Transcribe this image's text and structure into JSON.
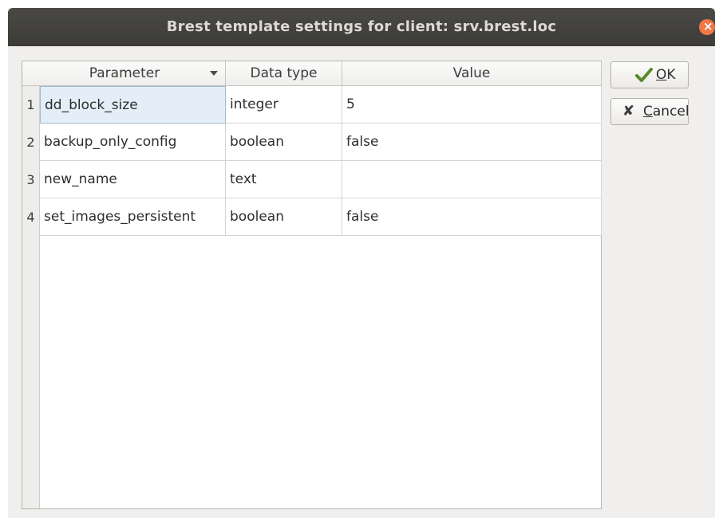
{
  "window": {
    "title": "Brest template settings for client: srv.brest.loc"
  },
  "table": {
    "columns": [
      "Parameter",
      "Data type",
      "Value"
    ],
    "rows": [
      {
        "num": "1",
        "parameter": "dd_block_size",
        "type": "integer",
        "value": "5"
      },
      {
        "num": "2",
        "parameter": "backup_only_config",
        "type": "boolean",
        "value": "false"
      },
      {
        "num": "3",
        "parameter": "new_name",
        "type": "text",
        "value": ""
      },
      {
        "num": "4",
        "parameter": "set_images_persistent",
        "type": "boolean",
        "value": "false"
      }
    ]
  },
  "buttons": {
    "ok": {
      "mnemonic": "O",
      "rest": "K"
    },
    "cancel": {
      "mnemonic": "C",
      "rest": "ancel"
    }
  },
  "colors": {
    "titlebar": "#3c3b37",
    "close": "#f07746",
    "selection": "#e3eef8"
  }
}
